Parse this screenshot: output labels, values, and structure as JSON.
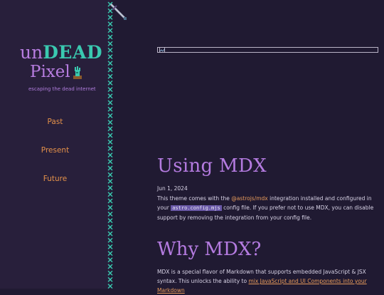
{
  "brand": {
    "logo_part1": "un",
    "logo_part2": "DEAD",
    "logo_part3": "Pixel",
    "tagline": "escaping the dead internet"
  },
  "nav": {
    "items": [
      {
        "label": "Past"
      },
      {
        "label": "Present"
      },
      {
        "label": "Future"
      }
    ]
  },
  "post": {
    "title": "Using MDX",
    "date": "Jun 1, 2024",
    "p1_a": "This theme comes with the ",
    "p1_link": "@astrojs/mdx",
    "p1_b": " integration installed and configured in your ",
    "p1_code": "astro.config.mjs",
    "p1_c": " config file. If you prefer not to use MDX, you can disable support by removing the integration from your config file.",
    "section_title": "Why MDX?",
    "p2_a": "MDX is a special flavor of Markdown that supports embedded JavaScript & JSX syntax. This unlocks the ability to ",
    "p2_link": "mix JavaScript and UI Components into your Markdown"
  },
  "colors": {
    "background": "#201a32",
    "sidebar": "#281f3b",
    "accent_purple": "#b47be0",
    "accent_teal": "#3ac9b0",
    "link_orange": "#e79b5b",
    "code_bg": "#6a59a8"
  },
  "icons": [
    "sword-icon",
    "zombie-hand-icon",
    "broken-image-icon",
    "stitch-border"
  ]
}
